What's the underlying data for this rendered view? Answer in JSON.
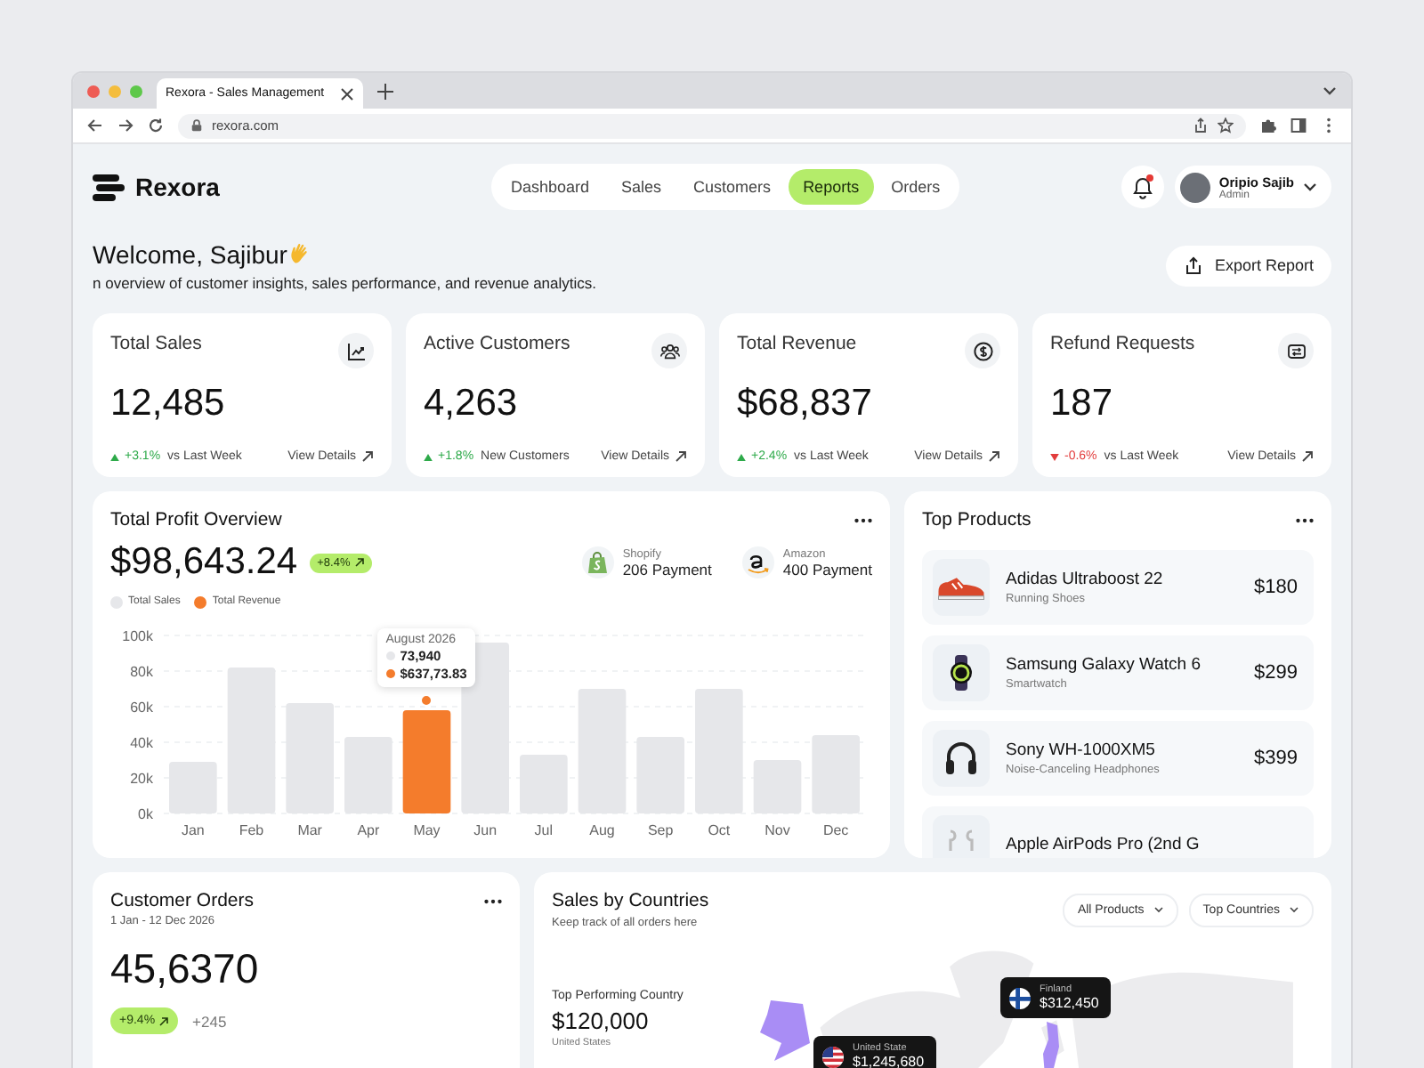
{
  "browser": {
    "tab_title": "Rexora - Sales Management",
    "url": "rexora.com"
  },
  "nav": {
    "brand": "Rexora",
    "tabs": [
      {
        "label": "Dashboard",
        "selected": false
      },
      {
        "label": "Sales",
        "selected": false
      },
      {
        "label": "Customers",
        "selected": false
      },
      {
        "label": "Reports",
        "selected": true
      },
      {
        "label": "Orders",
        "selected": false
      }
    ],
    "notification": {
      "unread": true
    },
    "user": {
      "name": "Oripio Sajib",
      "role": "Admin"
    }
  },
  "welcome": {
    "title": "Welcome, Sajibur",
    "subtitle": "n overview of customer insights, sales performance, and revenue analytics.",
    "export_button": "Export Report"
  },
  "stats": [
    {
      "title": "Total Sales",
      "kind": "sales",
      "value": "12,485",
      "rising": true,
      "delta": "+3.1%",
      "note": "vs Last Week",
      "link": "View Details"
    },
    {
      "title": "Active Customers",
      "kind": "customers",
      "value": "4,263",
      "rising": true,
      "delta": "+1.8%",
      "note": "New Customers",
      "link": "View Details"
    },
    {
      "title": "Total Revenue",
      "kind": "revenue",
      "value": "$68,837",
      "rising": true,
      "delta": "+2.4%",
      "note": "vs Last Week",
      "link": "View Details"
    },
    {
      "title": "Refund Requests",
      "kind": "refund",
      "value": "187",
      "rising": false,
      "delta": "-0.6%",
      "note": "vs Last Week",
      "link": "View Details"
    }
  ],
  "profit": {
    "title": "Total Profit Overview",
    "total": "$98,643.24",
    "badge": "+8.4%",
    "sources": [
      {
        "kind": "shopify",
        "name": "Shopify",
        "payments": "206 Payment"
      },
      {
        "kind": "amazon",
        "name": "Amazon",
        "payments": "400 Payment"
      }
    ],
    "tooltip": {
      "title": "August 2026",
      "rows": [
        {
          "value": "73,940",
          "color": "#e6e7ea"
        },
        {
          "value": "$637,73.83",
          "color": "#f47c2c"
        }
      ]
    },
    "chart_data": {
      "type": "bar",
      "categories": [
        "Jan",
        "Feb",
        "Mar",
        "Apr",
        "May",
        "Jun",
        "Jul",
        "Aug",
        "Sep",
        "Oct",
        "Nov",
        "Dec"
      ],
      "series": [
        {
          "name": "Total Sales",
          "color": "#e6e7ea",
          "values": [
            29000,
            82000,
            62000,
            43000,
            null,
            96000,
            33000,
            70000,
            43000,
            70000,
            30000,
            44000
          ]
        },
        {
          "name": "Total Revenue",
          "color": "#f47c2c",
          "values": [
            null,
            null,
            null,
            null,
            58000,
            null,
            null,
            null,
            null,
            null,
            null,
            null
          ]
        }
      ],
      "grid": true,
      "ylim": [
        0,
        100000
      ],
      "yticks": [
        {
          "value": 0,
          "label": "0k"
        },
        {
          "value": 20000,
          "label": "20k"
        },
        {
          "value": 40000,
          "label": "40k"
        },
        {
          "value": 60000,
          "label": "60k"
        },
        {
          "value": 80000,
          "label": "80k"
        },
        {
          "value": 100000,
          "label": "100k"
        }
      ]
    }
  },
  "top_products": {
    "title": "Top Products",
    "items": [
      {
        "kind": "shoe",
        "name": "Adidas Ultraboost 22",
        "category": "Running Shoes",
        "price": "$180"
      },
      {
        "kind": "watch",
        "name": "Samsung Galaxy Watch 6",
        "category": "Smartwatch",
        "price": "$299"
      },
      {
        "kind": "headphones",
        "name": "Sony WH-1000XM5",
        "category": "Noise-Canceling Headphones",
        "price": "$399"
      },
      {
        "kind": "earbuds",
        "name": "Apple AirPods Pro (2nd G"
      }
    ]
  },
  "orders": {
    "title": "Customer Orders",
    "range": "1 Jan - 12 Dec 2026",
    "value": "45,6370",
    "badge": "+9.4%",
    "extra": "+245"
  },
  "countries": {
    "title": "Sales by Countries",
    "subtitle": "Keep track of all orders here",
    "filters": [
      "All Products",
      "Top Countries"
    ],
    "top": {
      "label": "Top Performing Country",
      "value": "$120,000",
      "country": "United States"
    },
    "markers": [
      {
        "kind": "fi",
        "country": "Finland",
        "value": "$312,450"
      },
      {
        "kind": "us",
        "country": "United State",
        "value": "$1,245,680"
      }
    ]
  }
}
